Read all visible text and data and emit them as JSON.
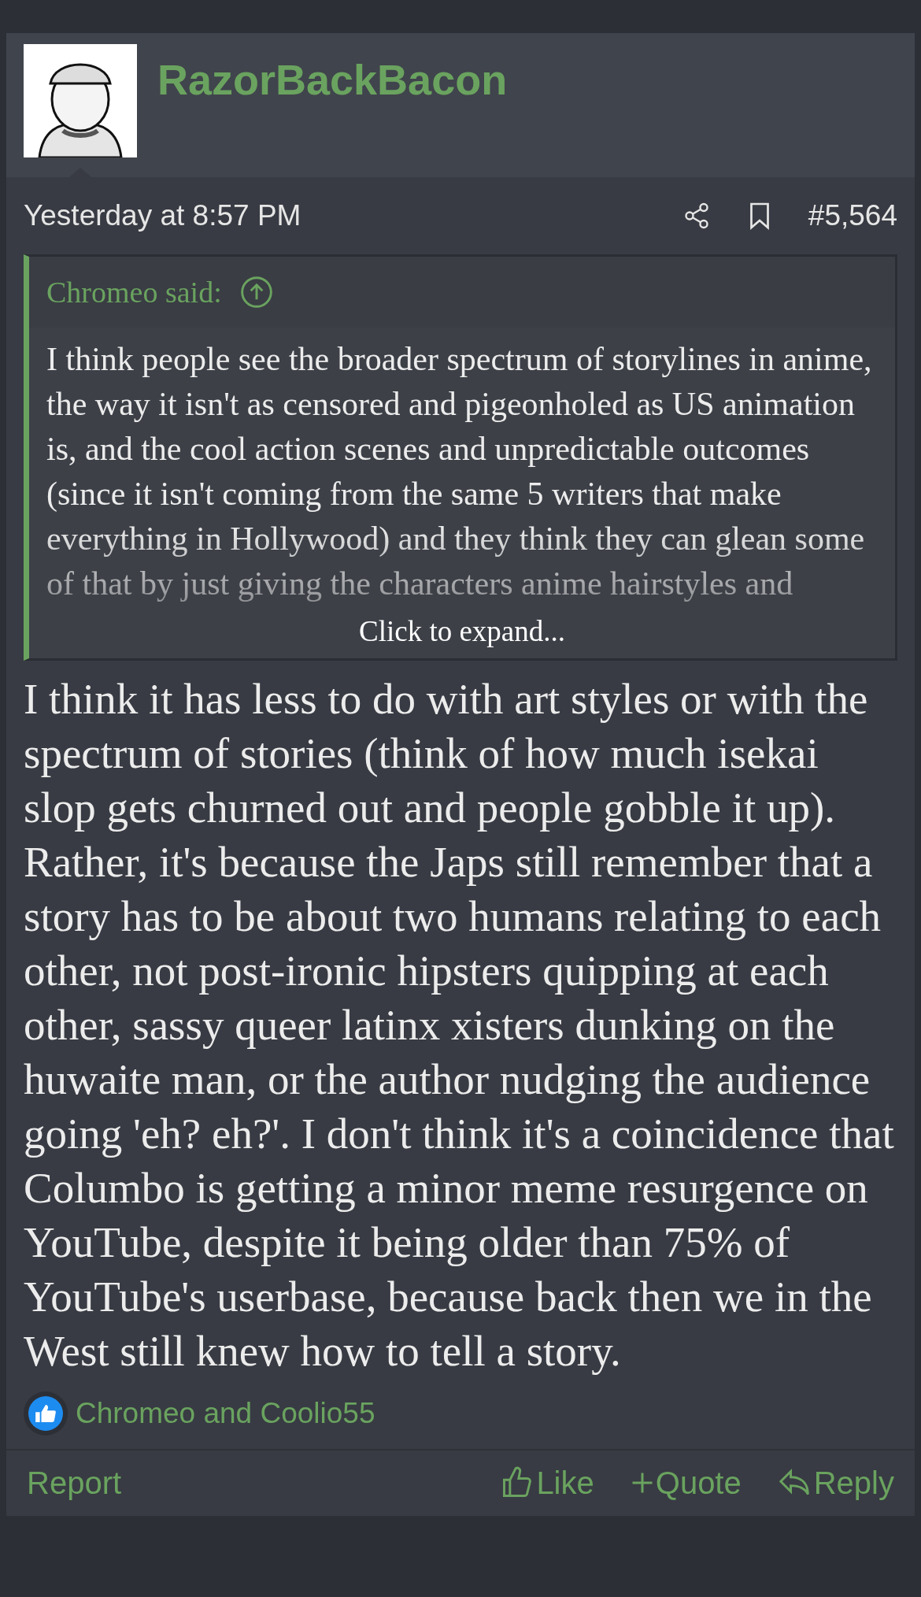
{
  "post": {
    "author": "RazorBackBacon",
    "time": "Yesterday at 8:57 PM",
    "number": "#5,564",
    "quote": {
      "attribution": "Chromeo said:",
      "text": "I think people see the broader spectrum of storylines in anime, the way it isn't as censored and pigeonholed as US animation is, and the cool action scenes and unpredictable outcomes (since it isn't coming from the same 5 writers that make everything in Hollywood) and they think they can glean some of that by just giving the characters anime hairstyles and",
      "expand": "Click to expand..."
    },
    "body": "I think it has less to do with art styles or with the spectrum of stories (think of how much isekai slop gets churned out and people gobble it up). Rather, it's because the Japs still remember that a story has to be about two humans relating to each other, not post-ironic hipsters quipping at each other, sassy queer latinx xisters dunking on the huwaite man, or the author nudging the audience going 'eh? eh?'. I don't think it's a coincidence that Columbo is getting a minor meme resurgence on YouTube, despite it being older than 75% of YouTube's userbase, because back then we in the West still knew how to tell a story.",
    "reactions": "Chromeo and Coolio55",
    "actions": [
      {
        "kind": "report",
        "label": "Report"
      },
      {
        "kind": "like",
        "label": "Like"
      },
      {
        "kind": "quote",
        "label": "Quote"
      },
      {
        "kind": "reply",
        "label": "Reply"
      }
    ]
  }
}
